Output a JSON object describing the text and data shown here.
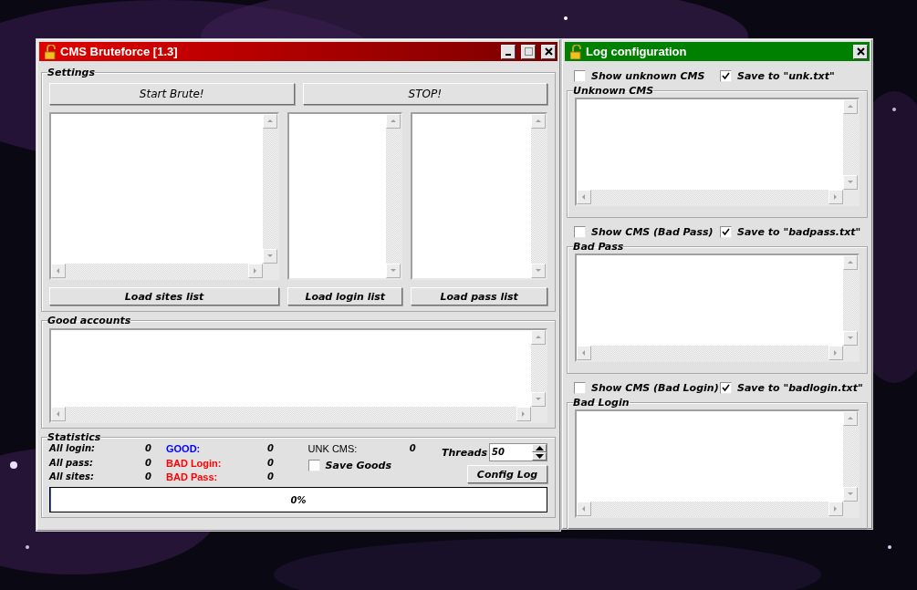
{
  "main_window": {
    "title": "CMS Bruteforce [1.3]",
    "settings": {
      "label": "Settings",
      "buttons": [
        "Start Brute!",
        "STOP!"
      ],
      "load_buttons": [
        "Load sites list",
        "Load login list",
        "Load pass list"
      ]
    },
    "good_accounts": {
      "label": "Good accounts"
    },
    "statistics": {
      "label": "Statistics",
      "counters": [
        {
          "label": "All login:",
          "value": "0",
          "color": "#000000"
        },
        {
          "label": "All pass:",
          "value": "0",
          "color": "#000000"
        },
        {
          "label": "All sites:",
          "value": "0",
          "color": "#000000"
        },
        {
          "label": "GOOD:",
          "value": "0",
          "color": "#0000ff"
        },
        {
          "label": "BAD Login:",
          "value": "0",
          "color": "#ff0000"
        },
        {
          "label": "BAD Pass:",
          "value": "0",
          "color": "#ff0000"
        }
      ],
      "unk_cms": {
        "label": "UNK CMS:",
        "value": "0"
      },
      "threads": {
        "label": "Threads",
        "value": "50"
      },
      "save_goods": {
        "label": "Save Goods",
        "checked": false
      },
      "config_log": "Config Log",
      "progress": {
        "level": 0,
        "text": "0%"
      }
    }
  },
  "log_window": {
    "title": "Log configuration",
    "sections": [
      {
        "show": {
          "label": "Show unknown CMS",
          "checked": false
        },
        "save": {
          "label": "Save to \"unk.txt\"",
          "checked": true
        },
        "group": "Unknown CMS"
      },
      {
        "show": {
          "label": "Show CMS (Bad Pass)",
          "checked": false
        },
        "save": {
          "label": "Save to \"badpass.txt\"",
          "checked": true
        },
        "group": "Bad Pass"
      },
      {
        "show": {
          "label": "Show CMS (Bad Login)",
          "checked": false
        },
        "save": {
          "label": "Save to \"badlogin.txt\"",
          "checked": true
        },
        "group": "Bad Login"
      }
    ]
  }
}
